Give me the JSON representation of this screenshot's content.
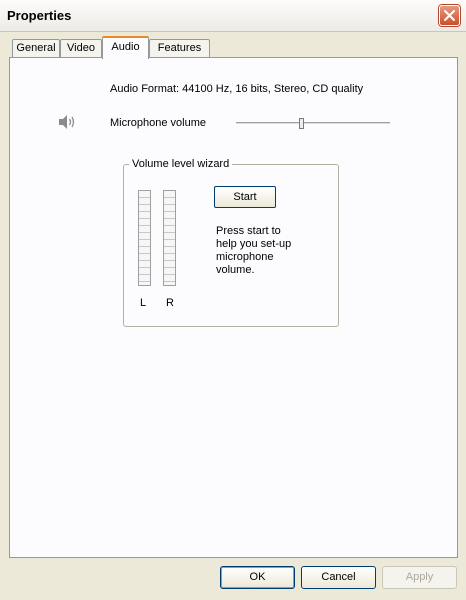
{
  "window": {
    "title": "Properties"
  },
  "tabs": [
    {
      "label": "General"
    },
    {
      "label": "Video"
    },
    {
      "label": "Audio"
    },
    {
      "label": "Features"
    }
  ],
  "active_tab": "Audio",
  "audio": {
    "format_text": "Audio Format: 44100 Hz, 16 bits, Stereo, CD quality",
    "mic_label": "Microphone volume",
    "mic_volume_fraction": 0.42
  },
  "wizard": {
    "title": "Volume level wizard",
    "start_label": "Start",
    "help_text": "Press start to\nhelp you set-up\nmicrophone\nvolume.",
    "left_label": "L",
    "right_label": "R"
  },
  "buttons": {
    "ok": "OK",
    "cancel": "Cancel",
    "apply": "Apply"
  },
  "colors": {
    "accent_tab": "#e68b2c",
    "close_red": "#c94f2c",
    "dialog_bg": "#ece9d8"
  },
  "icons": {
    "speaker": "speaker-icon",
    "close": "close-icon"
  }
}
